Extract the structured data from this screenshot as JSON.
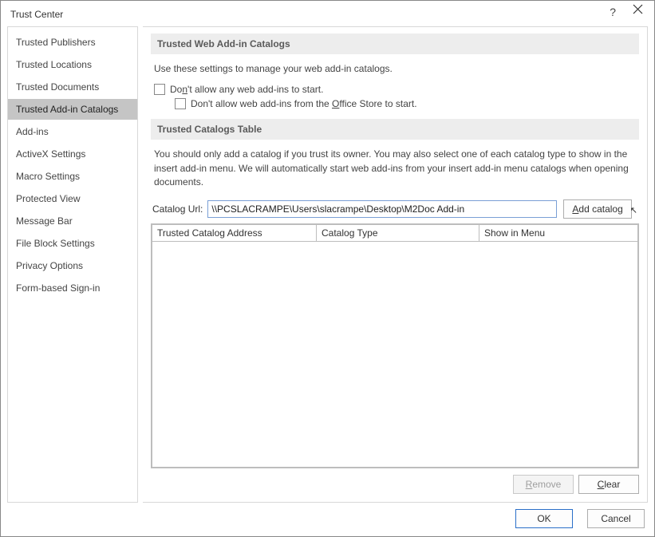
{
  "window": {
    "title": "Trust Center",
    "help": "?",
    "close": "×"
  },
  "sidebar": {
    "items": [
      {
        "label": "Trusted Publishers",
        "selected": false
      },
      {
        "label": "Trusted Locations",
        "selected": false
      },
      {
        "label": "Trusted Documents",
        "selected": false
      },
      {
        "label": "Trusted Add-in Catalogs",
        "selected": true
      },
      {
        "label": "Add-ins",
        "selected": false
      },
      {
        "label": "ActiveX Settings",
        "selected": false
      },
      {
        "label": "Macro Settings",
        "selected": false
      },
      {
        "label": "Protected View",
        "selected": false
      },
      {
        "label": "Message Bar",
        "selected": false
      },
      {
        "label": "File Block Settings",
        "selected": false
      },
      {
        "label": "Privacy Options",
        "selected": false
      },
      {
        "label": "Form-based Sign-in",
        "selected": false
      }
    ]
  },
  "section1": {
    "header": "Trusted Web Add-in Catalogs",
    "desc": "Use these settings to manage your web add-in catalogs.",
    "chk1_pre": "Do",
    "chk1_acc": "n",
    "chk1_post": "'t allow any web add-ins to start.",
    "chk2_pre": "Don't allow web add-ins from the ",
    "chk2_acc": "O",
    "chk2_post": "ffice Store to start."
  },
  "section2": {
    "header": "Trusted Catalogs Table",
    "desc": "You should only add a catalog if you trust its owner. You may also select one of each catalog type to show in the insert add-in menu. We will automatically start web add-ins from your insert add-in menu catalogs when opening documents.",
    "url_label": "Catalog Url:",
    "url_value": "\\\\PCSLACRAMPE\\Users\\slacrampe\\Desktop\\M2Doc Add-in",
    "add_btn_acc": "A",
    "add_btn_rest": "dd catalog",
    "table": {
      "col_addr": "Trusted Catalog Address",
      "col_type": "Catalog Type",
      "col_menu": "Show in Menu"
    },
    "remove_acc": "R",
    "remove_rest": "emove",
    "clear_acc": "C",
    "clear_rest": "lear"
  },
  "dialog": {
    "ok": "OK",
    "cancel": "Cancel"
  }
}
